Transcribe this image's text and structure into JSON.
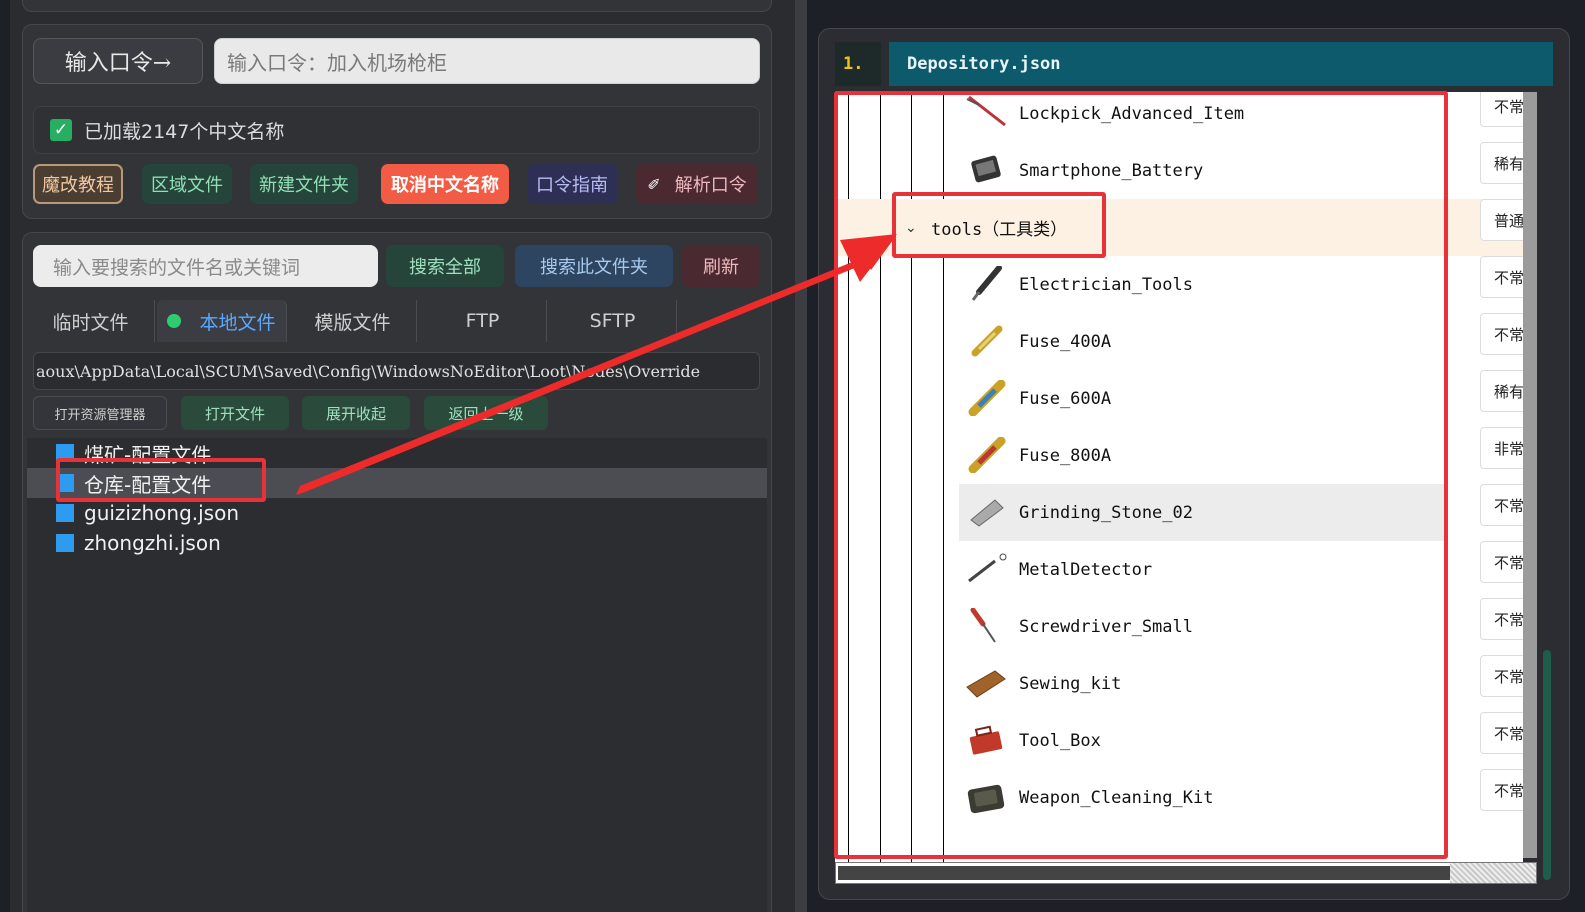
{
  "left": {
    "command_label": "输入口令→",
    "command_placeholder": "输入口令：加入机场枪柜",
    "loaded_text": "已加载2147个中文名称",
    "buttons": {
      "tutorial": "魔改教程",
      "region_file": "区域文件",
      "new_folder": "新建文件夹",
      "cancel_cn_names": "取消中文名称",
      "command_guide": "口令指南",
      "parse_command": "解析口令"
    },
    "search": {
      "placeholder": "输入要搜索的文件名或关键词",
      "search_all": "搜索全部",
      "search_folder": "搜索此文件夹",
      "refresh": "刷新"
    },
    "tabs": [
      "临时文件",
      "本地文件",
      "模版文件",
      "FTP",
      "SFTP"
    ],
    "path": "aoux\\AppData\\Local\\SCUM\\Saved\\Config\\WindowsNoEditor\\Loot\\Nodes\\Override",
    "actions": {
      "open_explorer": "打开资源管理器",
      "open_file": "打开文件",
      "expand_collapse": "展开收起",
      "go_up": "返回上一级"
    },
    "files": [
      {
        "name": "煤矿-配置文件",
        "selected": false
      },
      {
        "name": "仓库-配置文件",
        "selected": true
      },
      {
        "name": "guizizhong.json",
        "selected": false
      },
      {
        "name": "zhongzhi.json",
        "selected": false
      }
    ]
  },
  "right": {
    "tab_number": "1.",
    "tab_title": "Depository.json",
    "category": {
      "name": "tools（工具类）",
      "rarity": "普通"
    },
    "items": [
      {
        "name": "Lockpick_Advanced_Item",
        "rarity": "不常",
        "icon": "lockpick-icon"
      },
      {
        "name": "Smartphone_Battery",
        "rarity": "稀有",
        "icon": "battery-icon"
      },
      {
        "name": "Electrician_Tools",
        "rarity": "不常",
        "icon": "electrician-tools-icon"
      },
      {
        "name": "Fuse_400A",
        "rarity": "不常",
        "icon": "fuse-icon"
      },
      {
        "name": "Fuse_600A",
        "rarity": "稀有",
        "icon": "fuse-icon"
      },
      {
        "name": "Fuse_800A",
        "rarity": "非常",
        "icon": "fuse-icon"
      },
      {
        "name": "Grinding_Stone_02",
        "rarity": "不常",
        "icon": "grinding-stone-icon"
      },
      {
        "name": "MetalDetector",
        "rarity": "不常",
        "icon": "metal-detector-icon"
      },
      {
        "name": "Screwdriver_Small",
        "rarity": "不常",
        "icon": "screwdriver-icon"
      },
      {
        "name": "Sewing_kit",
        "rarity": "不常",
        "icon": "sewing-kit-icon"
      },
      {
        "name": "Tool_Box",
        "rarity": "不常",
        "icon": "toolbox-icon"
      },
      {
        "name": "Weapon_Cleaning_Kit",
        "rarity": "不常",
        "icon": "cleaning-kit-icon"
      }
    ]
  }
}
